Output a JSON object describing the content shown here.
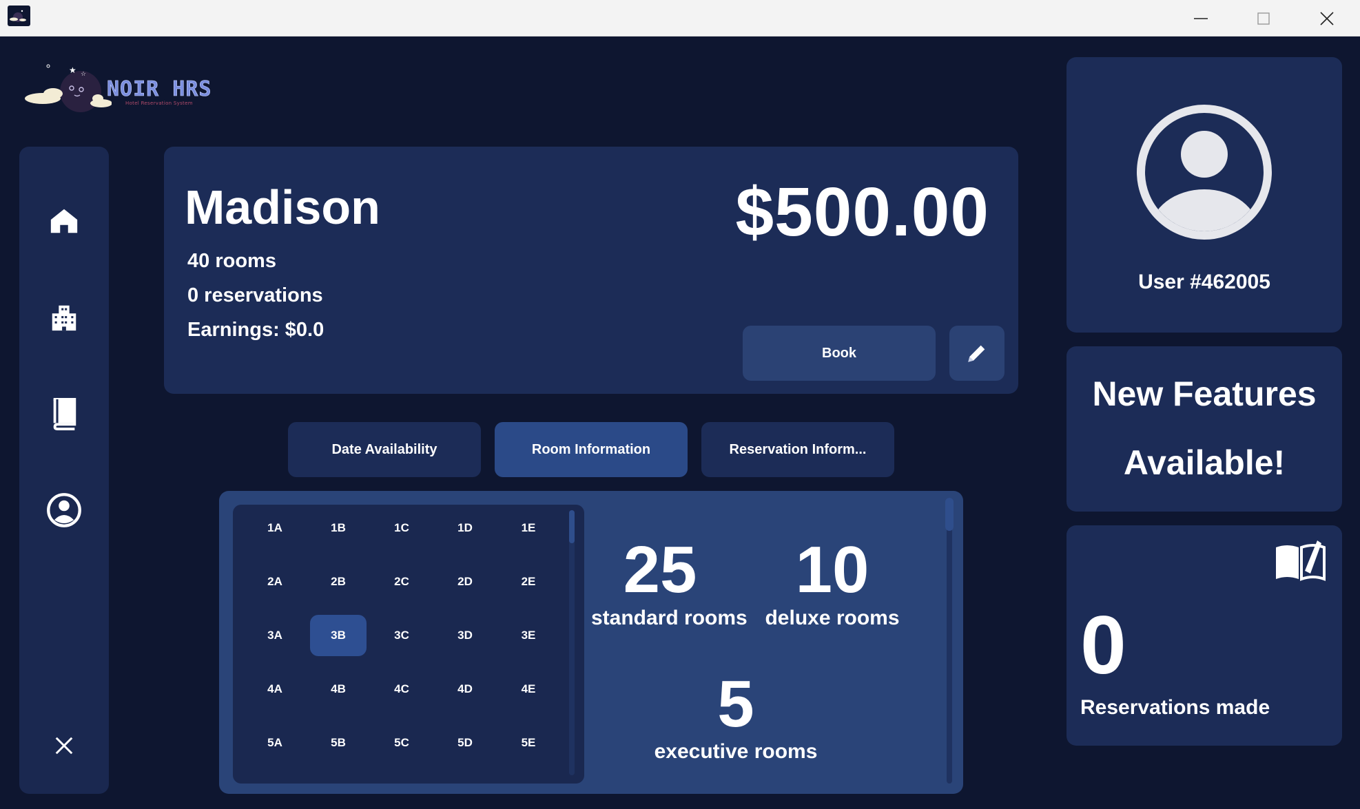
{
  "window": {
    "minimize_icon": "minimize-icon",
    "maximize_icon": "maximize-icon",
    "close_icon": "close-icon"
  },
  "logo": {
    "title": "NOIR HRS",
    "subtitle": "Hotel Reservation System"
  },
  "sidebar": {
    "items": [
      {
        "icon": "home-icon"
      },
      {
        "icon": "building-icon"
      },
      {
        "icon": "book-icon"
      },
      {
        "icon": "user-circle-icon"
      },
      {
        "icon": "close-icon"
      }
    ]
  },
  "hotel": {
    "name": "Madison",
    "price": "$500.00",
    "rooms": "40 rooms",
    "reservations": "0 reservations",
    "earnings": "Earnings: $0.0",
    "book_label": "Book",
    "edit_icon": "pencil-icon"
  },
  "tabs": [
    {
      "label": "Date Availability",
      "active": false
    },
    {
      "label": "Room Information",
      "active": true
    },
    {
      "label": "Reservation Inform...",
      "active": false
    }
  ],
  "rooms": {
    "grid": [
      [
        "1A",
        "1B",
        "1C",
        "1D",
        "1E"
      ],
      [
        "2A",
        "2B",
        "2C",
        "2D",
        "2E"
      ],
      [
        "3A",
        "3B",
        "3C",
        "3D",
        "3E"
      ],
      [
        "4A",
        "4B",
        "4C",
        "4D",
        "4E"
      ],
      [
        "5A",
        "5B",
        "5C",
        "5D",
        "5E"
      ]
    ],
    "selected": "3B",
    "standard_count": "25",
    "standard_label": "standard rooms",
    "deluxe_count": "10",
    "deluxe_label": "deluxe rooms",
    "executive_count": "5",
    "executive_label": "executive rooms"
  },
  "user": {
    "avatar_icon": "user-avatar-icon",
    "id": "User #462005"
  },
  "news": {
    "line1": "New Features",
    "line2": "Available!"
  },
  "stats": {
    "icon": "open-book-icon",
    "reservations_count": "0",
    "reservations_label": "Reservations made"
  },
  "colors": {
    "background": "#0e1630",
    "card": "#1c2c57",
    "panel": "#2a4478",
    "accent": "#2e4f92"
  }
}
